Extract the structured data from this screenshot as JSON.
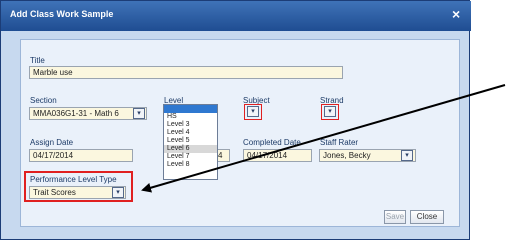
{
  "dialog": {
    "title": "Add Class Work Sample",
    "close_glyph": "×"
  },
  "form": {
    "title": {
      "label": "Title",
      "value": "Marble use"
    },
    "section": {
      "label": "Section",
      "value": "MMA036G1-31 - Math 6"
    },
    "level": {
      "label": "Level",
      "options": [
        "",
        "HS",
        "Level 3",
        "Level 4",
        "Level 5",
        "Level 6",
        "Level 7",
        "Level 8"
      ],
      "selected_index": 0,
      "hover_index": 5
    },
    "subject": {
      "label": "Subject"
    },
    "strand": {
      "label": "Strand"
    },
    "assign_date": {
      "label": "Assign Date",
      "value": "04/17/2014"
    },
    "due_date": {
      "value_fragment": "4"
    },
    "completed_date": {
      "label": "Completed Date",
      "value": "04/17/2014"
    },
    "staff_rater": {
      "label": "Staff Rater",
      "value": "Jones, Becky"
    },
    "performance_level_type": {
      "label": "Performance Level Type",
      "value": "Trait Scores"
    }
  },
  "buttons": {
    "save": "Save",
    "close": "Close"
  },
  "colors": {
    "highlight": "#e02020",
    "arrow": "#000000",
    "titlebar": "#2a5aa0"
  }
}
